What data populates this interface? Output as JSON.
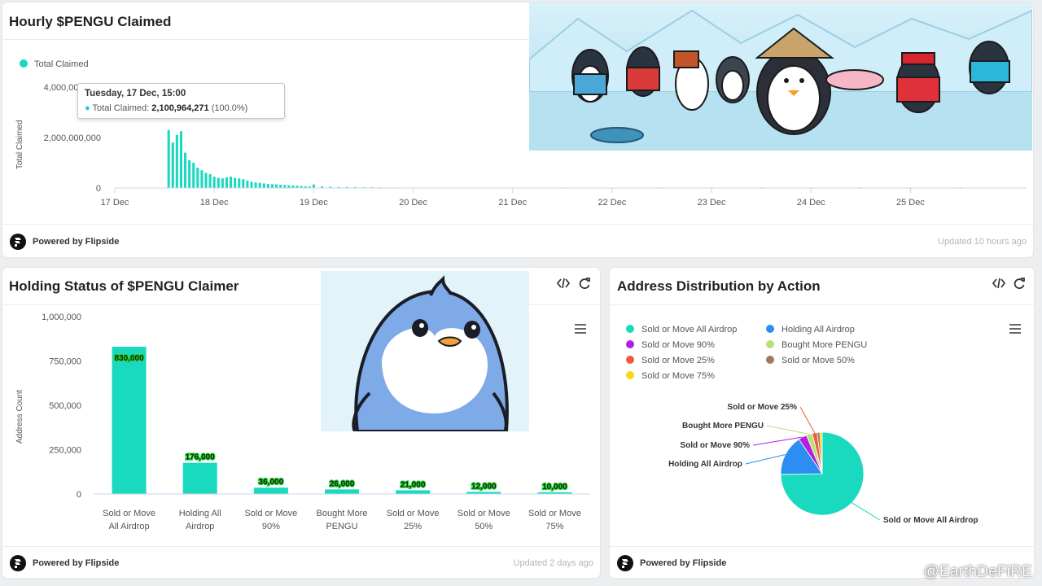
{
  "top_panel": {
    "title": "Hourly $PENGU Claimed",
    "legend": "Total Claimed",
    "ylabel": "Total Claimed",
    "updated": "Updated 10 hours ago",
    "footer": "Powered by Flipside",
    "tooltip": {
      "date": "Tuesday, 17 Dec, 15:00",
      "series": "Total Claimed:",
      "value": "2,100,964,271",
      "pct": "(100.0%)"
    }
  },
  "holding_panel": {
    "title": "Holding Status of $PENGU Claimer",
    "ylabel": "Address Count",
    "updated": "Updated 2 days ago",
    "footer": "Powered by Flipside"
  },
  "address_panel": {
    "title": "Address Distribution by Action",
    "footer": "Powered by Flipside"
  },
  "watermark": "@EarthDeFiRE",
  "colors": {
    "teal": "#19d9bf",
    "blue": "#2b8ef0",
    "purple": "#b41ee0",
    "green_light": "#b7e07a",
    "red": "#ef5a3a",
    "brown": "#a3795a",
    "yellow": "#f6d80e"
  },
  "icons": [
    "code-icon",
    "refresh-icon",
    "menu-icon",
    "flipside-logo-icon"
  ],
  "chart_data": [
    {
      "type": "bar",
      "title": "Hourly $PENGU Claimed",
      "ylabel": "Total Claimed",
      "series": [
        {
          "name": "Total Claimed"
        }
      ],
      "xticks": [
        "17 Dec",
        "18 Dec",
        "19 Dec",
        "20 Dec",
        "21 Dec",
        "22 Dec",
        "23 Dec",
        "24 Dec",
        "25 Dec"
      ],
      "yticks": [
        "0",
        "2,000,000,000",
        "4,000,000,000"
      ],
      "ylim": [
        0,
        4000000000
      ],
      "x_hours": [
        13,
        14,
        15,
        16,
        17,
        18,
        19,
        20,
        21,
        22,
        23,
        24,
        25,
        26,
        27,
        28,
        29,
        30,
        31,
        32,
        33,
        34,
        35,
        36,
        37,
        38,
        39,
        40,
        41,
        42,
        43,
        44,
        45,
        46,
        47,
        48,
        50,
        52,
        54,
        56,
        58,
        60,
        62,
        64,
        66,
        68,
        72,
        78,
        84,
        96,
        108,
        120,
        132,
        144,
        156,
        168,
        180,
        192,
        204
      ],
      "values": [
        2300000000,
        1800000000,
        2100964271,
        2250000000,
        1400000000,
        1100000000,
        1000000000,
        800000000,
        700000000,
        600000000,
        550000000,
        450000000,
        400000000,
        380000000,
        420000000,
        450000000,
        400000000,
        380000000,
        350000000,
        300000000,
        250000000,
        220000000,
        200000000,
        180000000,
        160000000,
        150000000,
        140000000,
        130000000,
        120000000,
        110000000,
        100000000,
        90000000,
        80000000,
        70000000,
        60000000,
        140000000,
        60000000,
        50000000,
        40000000,
        40000000,
        35000000,
        30000000,
        30000000,
        25000000,
        20000000,
        20000000,
        15000000,
        12000000,
        10000000,
        8000000,
        6000000,
        5000000,
        4000000,
        3000000,
        3000000,
        2000000,
        2000000,
        2000000,
        1000000
      ],
      "grid": false,
      "legend_position": "top-left"
    },
    {
      "type": "bar",
      "title": "Holding Status of $PENGU Claimer",
      "ylabel": "Address Count",
      "categories": [
        [
          "Sold or Move",
          "All Airdrop"
        ],
        [
          "Holding All",
          "Airdrop"
        ],
        [
          "Sold or Move",
          "90%"
        ],
        [
          "Bought More",
          "PENGU"
        ],
        [
          "Sold or Move",
          "25%"
        ],
        [
          "Sold or Move",
          "50%"
        ],
        [
          "Sold or Move",
          "75%"
        ]
      ],
      "values": [
        830000,
        176000,
        36000,
        26000,
        21000,
        12000,
        10000
      ],
      "data_labels": [
        "830,000",
        "176,000",
        "36,000",
        "26,000",
        "21,000",
        "12,000",
        "10,000"
      ],
      "yticks": [
        "0",
        "250,000",
        "500,000",
        "750,000",
        "1,000,000"
      ],
      "ylim": [
        0,
        1000000
      ],
      "grid": false
    },
    {
      "type": "pie",
      "title": "Address Distribution by Action",
      "legend": [
        "Sold or Move All Airdrop",
        "Holding All Airdrop",
        "Sold or Move 90%",
        "Bought More PENGU",
        "Sold or Move 25%",
        "Sold or Move 50%",
        "Sold or Move 75%"
      ],
      "legend_position": "top",
      "slices": [
        {
          "label": "Sold or Move All Airdrop",
          "value": 830000,
          "color": "#19d9bf",
          "callout": "Sold or Move All Airdrop"
        },
        {
          "label": "Holding All Airdrop",
          "value": 176000,
          "color": "#2b8ef0",
          "callout": "Holding All Airdrop"
        },
        {
          "label": "Sold or Move 90%",
          "value": 36000,
          "color": "#b41ee0",
          "callout": "Sold or Move 90%"
        },
        {
          "label": "Bought More PENGU",
          "value": 26000,
          "color": "#b7e07a",
          "callout": "Bought More PENGU"
        },
        {
          "label": "Sold or Move 25%",
          "value": 21000,
          "color": "#ef5a3a",
          "callout": "Sold or Move 25%"
        },
        {
          "label": "Sold or Move 50%",
          "value": 12000,
          "color": "#a3795a",
          "callout": ""
        },
        {
          "label": "Sold or Move 75%",
          "value": 10000,
          "color": "#f6d80e",
          "callout": ""
        }
      ]
    }
  ]
}
